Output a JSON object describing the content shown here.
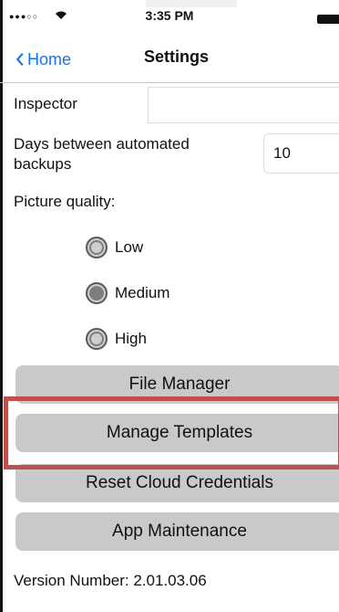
{
  "status_bar": {
    "signal": "●●●○○",
    "wifi_icon": "wifi-icon",
    "time": "3:35 PM"
  },
  "nav": {
    "back_label": "Home",
    "title": "Settings"
  },
  "form": {
    "inspector_label": "Inspector",
    "inspector_value": "",
    "backup_label_line1": "Days between automated",
    "backup_label_line2": "backups",
    "backup_value": "10",
    "quality_label": "Picture quality:",
    "quality_options": [
      "Low",
      "Medium",
      "High"
    ],
    "quality_selected": "Medium"
  },
  "buttons": {
    "file_manager": "File Manager",
    "manage_templates": "Manage Templates",
    "reset_cloud": "Reset Cloud Credentials",
    "app_maintenance": "App Maintenance"
  },
  "footer": {
    "version": "Version Number: 2.01.03.06"
  },
  "colors": {
    "accent": "#1a73e8",
    "button_bg": "#c9c9c9",
    "highlight": "#c0504d"
  }
}
